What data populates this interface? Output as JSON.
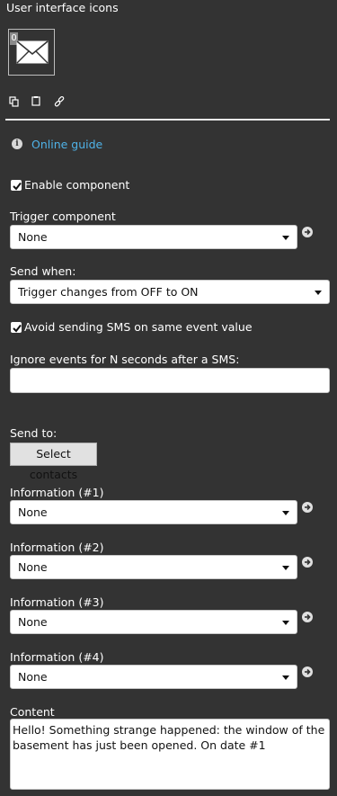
{
  "header": {
    "title": "User interface icons"
  },
  "icon_preview": {
    "badge": "0",
    "icon": "envelope-icon"
  },
  "toolbar": {
    "icons": [
      "copy-icon",
      "paste-icon",
      "link-icon"
    ]
  },
  "guide": {
    "icon": "info-icon",
    "link_label": "Online guide",
    "link_color": "#4fb3e8"
  },
  "enable": {
    "label": "Enable component",
    "checked": true
  },
  "trigger": {
    "label": "Trigger component",
    "value": "None"
  },
  "send_when": {
    "label": "Send when:",
    "value": "Trigger changes from OFF to ON"
  },
  "avoid": {
    "label": "Avoid sending SMS on same event value",
    "checked": true
  },
  "ignore": {
    "label": "Ignore events for N seconds after a SMS:",
    "value": ""
  },
  "send_to": {
    "label": "Send to:",
    "button_label": "Select contacts"
  },
  "information": [
    {
      "label": "Information (#1)",
      "value": "None"
    },
    {
      "label": "Information (#2)",
      "value": "None"
    },
    {
      "label": "Information (#3)",
      "value": "None"
    },
    {
      "label": "Information (#4)",
      "value": "None"
    }
  ],
  "content": {
    "label": "Content",
    "value": "Hello! Something strange happened: the window of the basement has just been opened. On date #1"
  },
  "colors": {
    "background": "#333333",
    "accent": "#4fb3e8"
  }
}
